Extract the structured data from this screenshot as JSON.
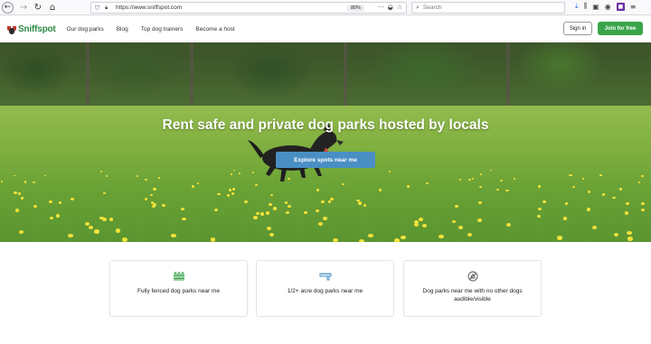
{
  "browser": {
    "url": "https://www.sniffspot.com",
    "zoom": "80%",
    "search_placeholder": "Search",
    "more_icon": "···"
  },
  "header": {
    "logo_text": "Sniffspot",
    "nav": [
      "Our dog parks",
      "Blog",
      "Top dog trainers",
      "Become a host"
    ],
    "signin_label": "Sign in",
    "join_label": "Join for free",
    "accent_color": "#3aa54a"
  },
  "hero": {
    "title": "Rent safe and private dog parks hosted by locals",
    "cta_label": "Explore spots near me",
    "cta_color": "#4a8fc4"
  },
  "features": [
    {
      "icon": "fence-icon",
      "label": "Fully fenced dog parks near me"
    },
    {
      "icon": "ruler-icon",
      "label": "1/2+ acre dog parks near me"
    },
    {
      "icon": "no-dogs-icon",
      "label": "Dog parks near me with no other dogs audible/visible"
    }
  ]
}
